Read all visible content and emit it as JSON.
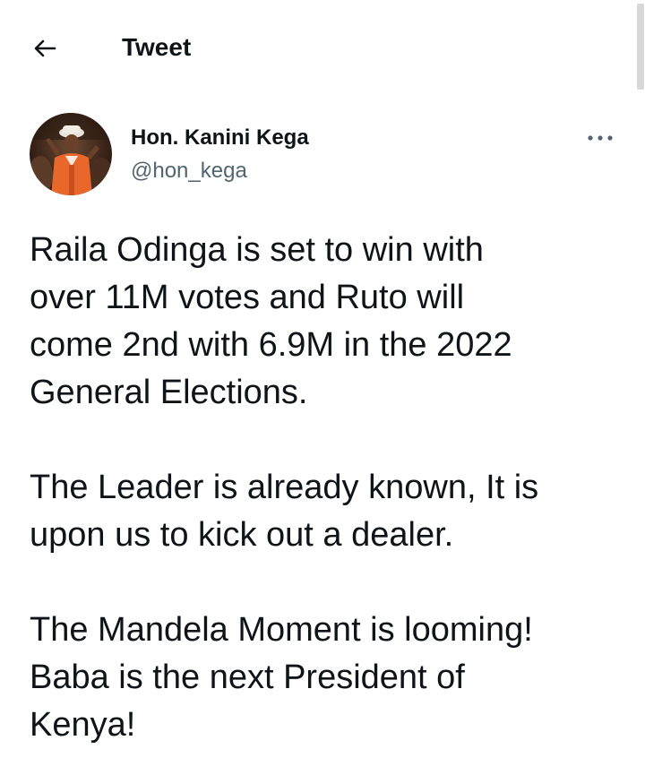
{
  "header": {
    "back_icon": "arrow-left-icon",
    "title": "Tweet"
  },
  "tweet": {
    "author": {
      "name": "Hon. Kanini Kega",
      "handle": "@hon_kega",
      "avatar_icon": "profile-photo"
    },
    "more_icon": "more-horizontal-icon",
    "paragraphs": [
      "Raila Odinga is set to win with\nover 11M votes and Ruto will\ncome 2nd with 6.9M in the 2022\nGeneral Elections.",
      "The Leader is already known, It is\nupon us to kick out a dealer.",
      "The Mandela Moment is looming!\nBaba is the next President of\nKenya!"
    ]
  },
  "colors": {
    "text_primary": "#0f1419",
    "text_secondary": "#536471",
    "background": "#ffffff"
  }
}
